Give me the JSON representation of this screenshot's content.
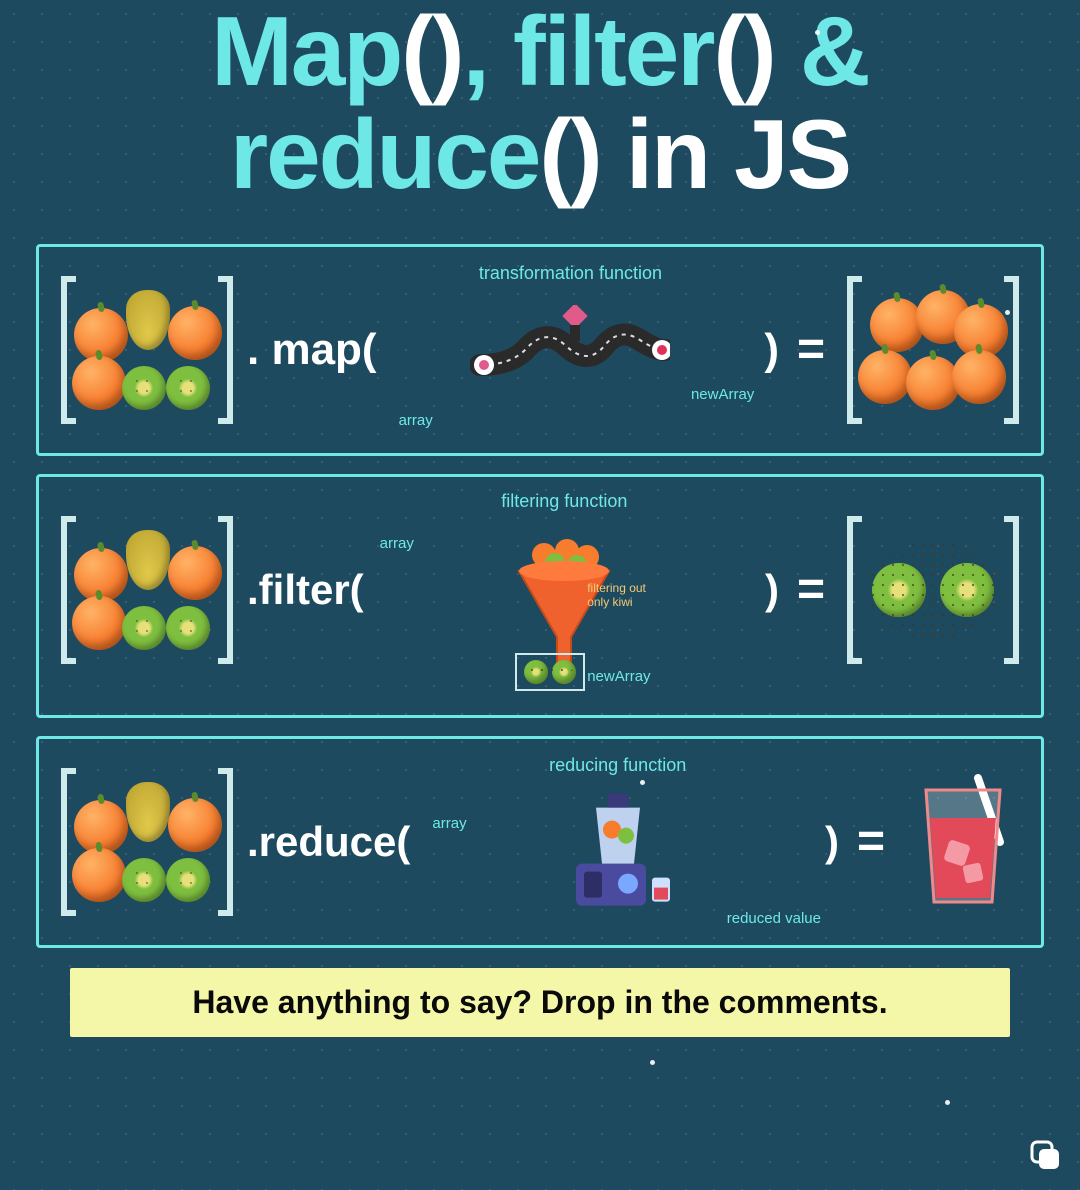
{
  "title": {
    "line1_part1": "Map",
    "line1_paren": "()",
    "line1_comma": ", ",
    "line1_part2": "filter",
    "line1_paren2": "()",
    "line1_amp": " &",
    "line2_part1": "reduce",
    "line2_paren": "()",
    "line2_rest": " in JS"
  },
  "panels": {
    "map": {
      "method_prefix": ". map(",
      "method_suffix": ")",
      "equals": "=",
      "ann_top": "transformation function",
      "ann_array": "array",
      "ann_newarray": "newArray"
    },
    "filter": {
      "method_prefix": ".filter(",
      "method_suffix": ")",
      "equals": "=",
      "ann_top": "filtering function",
      "ann_array": "array",
      "ann_note": "filtering out\nonly kiwi",
      "ann_newarray": "newArray"
    },
    "reduce": {
      "method_prefix": ".reduce(",
      "method_suffix": ")",
      "equals": "=",
      "ann_top": "reducing function",
      "ann_array": "array",
      "ann_reduced": "reduced value"
    }
  },
  "cta": "Have anything to say? Drop in the comments.",
  "colors": {
    "accent": "#6ee7e7",
    "bg": "#1e4a5f",
    "cta_bg": "#f4f7a8"
  }
}
